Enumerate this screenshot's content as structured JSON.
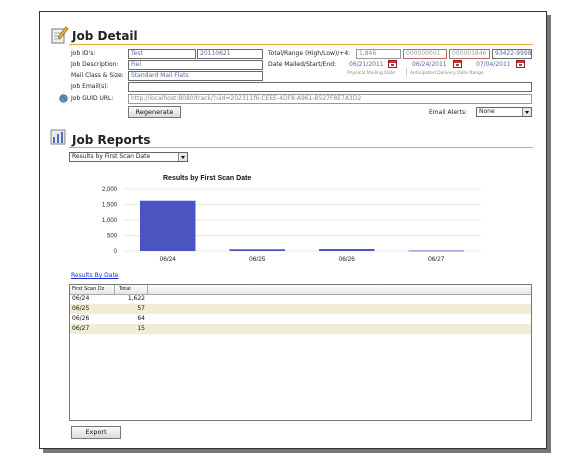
{
  "job_detail": {
    "title": "Job Detail",
    "job_ids_label": "Job ID's:",
    "job_id_1": "Test",
    "job_id_2": "20110621",
    "job_description_label": "Job Description:",
    "job_description": "Fiel",
    "mail_class_label": "Mail Class & Size:",
    "mail_class": "Standard Mail Flats",
    "job_email_label": "Job Email(s):",
    "job_email": "",
    "job_guid_label": "Job GUID URL:",
    "job_guid_url": "http://localhost:8080/track/?uid=202311f6-CEEE-4DF8-A961-B527F8E7A3D2",
    "total_range_label": "Total/Range (High/Low)/+4:",
    "total": "1,846",
    "range_low": "000000001",
    "range_high": "000001846",
    "plus4": "93422-9998",
    "date_label": "Date Mailed/Start/End:",
    "date_mailed": "06/21/2011",
    "date_start": "06/24/2011",
    "date_end": "07/04/2011",
    "physical_mailing_caption": "Physical Mailing Date",
    "anticipated_caption": "Anticipated Delivery Date Range",
    "regenerate_label": "Regenerate",
    "email_alerts_label": "Email Alerts:",
    "email_alerts_value": "None"
  },
  "job_reports": {
    "title": "Job Reports",
    "report_select": "Results by First Scan Date",
    "results_link": "Results By Date",
    "export_label": "Export"
  },
  "chart_data": {
    "type": "bar",
    "title": "Results by First Scan Date",
    "categories": [
      "06/24",
      "06/25",
      "06/26",
      "06/27"
    ],
    "values": [
      1622,
      57,
      64,
      15
    ],
    "yticks": [
      "2,000",
      "1,500",
      "1,000",
      "500",
      "0"
    ],
    "ylim": [
      0,
      2000
    ],
    "grid": true,
    "bar_color": "#4a55c2"
  },
  "table": {
    "columns": [
      "First Scan Dz",
      "Total"
    ],
    "rows": [
      [
        "06/24",
        "1,622"
      ],
      [
        "06/25",
        "57"
      ],
      [
        "06/26",
        "64"
      ],
      [
        "06/27",
        "15"
      ]
    ]
  }
}
